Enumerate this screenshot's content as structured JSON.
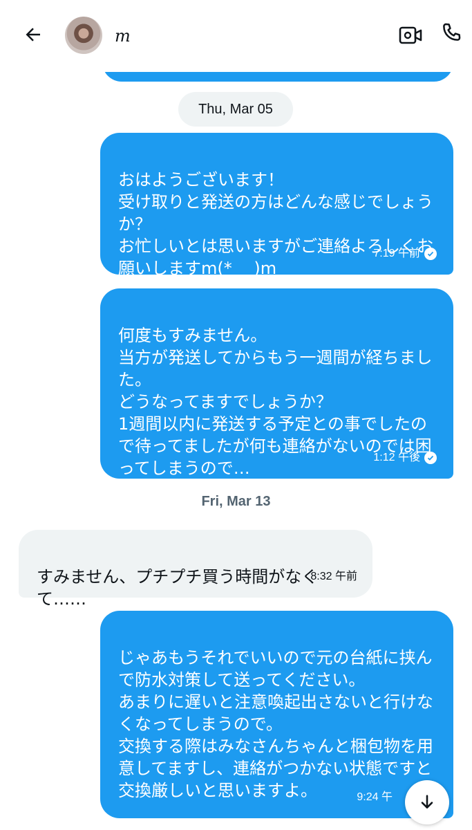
{
  "header": {
    "contact_name": "m",
    "icons": {
      "back": "back-arrow-icon",
      "video": "video-call-icon",
      "call": "phone-icon",
      "avatar": "profile-avatar"
    }
  },
  "conversation": {
    "date_1": "Thu, Mar 05",
    "date_2": "Fri, Mar 13",
    "messages": [
      {
        "direction": "out",
        "text": "おはようございます！\n受け取りと発送の方はどんな感じでしょうか？\nお忙しいとは思いますがご連絡よろしくお願いしますm(*_ _)m",
        "time": "7:19 午前"
      },
      {
        "direction": "out",
        "text": "何度もすみません。\n当方が発送してからもう一週間が経ちました。\nどうなってますでしょうか？\n1週間以内に発送する予定との事でしたので待ってましたが何も連絡がないのでは困ってしまうので…",
        "time": "1:12 午後"
      },
      {
        "direction": "in",
        "text": "すみません、プチプチ買う時間がなくて……",
        "time": "8:32 午前"
      },
      {
        "direction": "out",
        "text": "じゃあもうそれでいいので元の台紙に挟んで防水対策して送ってください。\nあまりに遅いと注意喚起出さないと行けなくなってしまうので。\n交換する際はみなさんちゃんと梱包物を用意してますし、連絡がつかない状態ですと交換厳しいと思いますよ。",
        "time": "9:24 午"
      }
    ]
  },
  "colors": {
    "outgoing_bubble": "#1d9bf0",
    "incoming_bubble": "#eff3f4",
    "text_dark": "#0f1419",
    "muted": "#536471"
  },
  "scroll_button": {
    "icon": "arrow-down-icon"
  }
}
